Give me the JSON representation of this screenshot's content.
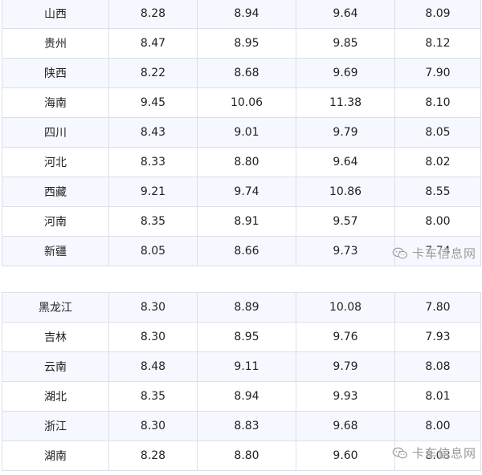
{
  "table1": {
    "rows": [
      [
        "山西",
        "8.28",
        "8.94",
        "9.64",
        "8.09"
      ],
      [
        "贵州",
        "8.47",
        "8.95",
        "9.85",
        "8.12"
      ],
      [
        "陕西",
        "8.22",
        "8.68",
        "9.69",
        "7.90"
      ],
      [
        "海南",
        "9.45",
        "10.06",
        "11.38",
        "8.10"
      ],
      [
        "四川",
        "8.43",
        "9.01",
        "9.79",
        "8.05"
      ],
      [
        "河北",
        "8.33",
        "8.80",
        "9.64",
        "8.02"
      ],
      [
        "西藏",
        "9.21",
        "9.74",
        "10.86",
        "8.55"
      ],
      [
        "河南",
        "8.35",
        "8.91",
        "9.57",
        "8.00"
      ],
      [
        "新疆",
        "8.05",
        "8.66",
        "9.73",
        "7.74"
      ]
    ]
  },
  "table2": {
    "rows": [
      [
        "黑龙江",
        "8.30",
        "8.89",
        "10.08",
        "7.80"
      ],
      [
        "吉林",
        "8.30",
        "8.95",
        "9.76",
        "7.93"
      ],
      [
        "云南",
        "8.48",
        "9.11",
        "9.79",
        "8.08"
      ],
      [
        "湖北",
        "8.35",
        "8.94",
        "9.93",
        "8.01"
      ],
      [
        "浙江",
        "8.30",
        "8.83",
        "9.68",
        "8.00"
      ],
      [
        "湖南",
        "8.28",
        "8.80",
        "9.60",
        "8.08"
      ]
    ]
  },
  "watermark": {
    "text": "卡车信息网",
    "icon": "wechat-icon",
    "color": "#9a9a9a"
  }
}
